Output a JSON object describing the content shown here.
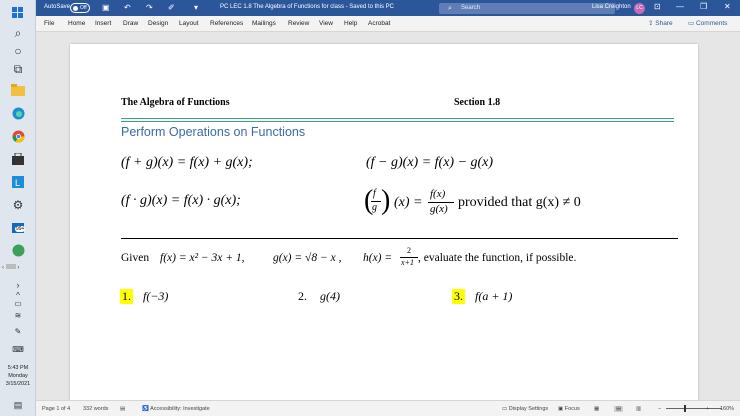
{
  "titlebar": {
    "autosave_label": "AutoSave",
    "autosave_state": "Off",
    "doc_title": "PC LEC 1.8 The Algebra of Functions for class  -  Saved to this PC",
    "search_placeholder": "Search",
    "user_name": "Lisa Creighton",
    "user_initials": "LC"
  },
  "ribbon": {
    "tabs": [
      "File",
      "Home",
      "Insert",
      "Draw",
      "Design",
      "Layout",
      "References",
      "Mailings",
      "Review",
      "View",
      "Help",
      "Acrobat"
    ],
    "share_label": "Share",
    "comments_label": "Comments"
  },
  "document": {
    "heading_left": "The Algebra of Functions",
    "heading_right": "Section 1.8",
    "section_title": "Perform Operations on Functions",
    "eq_sum": "(f + g)(x) = f(x) + g(x);",
    "eq_diff": "(f − g)(x) = f(x) − g(x)",
    "eq_prod": "(f · g)(x) = f(x) · g(x);",
    "eq_quot_fnum": "f",
    "eq_quot_fden": "g",
    "eq_quot_x": "(x) =",
    "eq_quot_num": "f(x)",
    "eq_quot_den": "g(x)",
    "eq_quot_cond": "provided that g(x) ≠ 0",
    "given_word": "Given",
    "given_f": "f(x) = x² − 3x + 1,",
    "given_g": "g(x) = √8 − x ,",
    "given_h_lhs": "h(x) =",
    "given_h_num": "2",
    "given_h_den": "x+1",
    "given_tail": ",  evaluate the function, if possible.",
    "problems": [
      {
        "num": "1.",
        "expr": "f(−3)"
      },
      {
        "num": "2.",
        "expr": "g(4)"
      },
      {
        "num": "3.",
        "expr": "f(a + 1)"
      }
    ]
  },
  "statusbar": {
    "page": "Page 1 of 4",
    "words": "332 words",
    "accessibility": "Accessibility: Investigate",
    "display_settings": "Display Settings",
    "focus": "Focus",
    "zoom": "160%"
  },
  "taskbar": {
    "time": "5:43 PM",
    "day": "Monday",
    "date": "3/15/2021",
    "badge": "99+"
  },
  "colors": {
    "title_bar": "#2b579a",
    "section_title": "#3a6aa8",
    "rule_green": "#3aa57a",
    "highlight": "#ffff00"
  }
}
